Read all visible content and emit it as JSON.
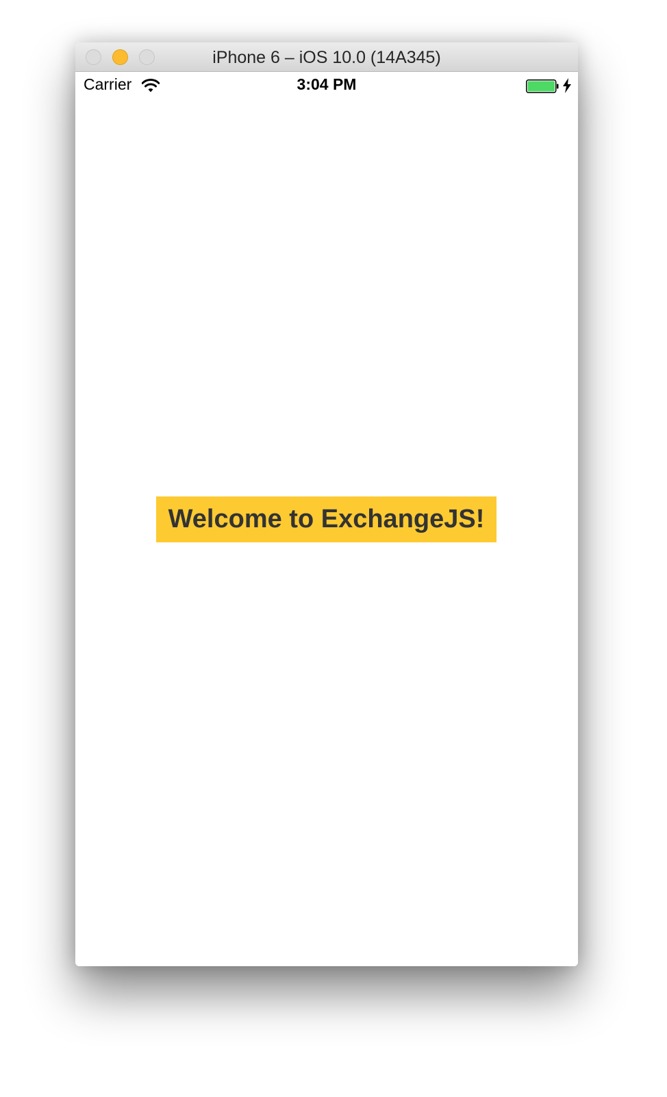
{
  "window": {
    "title": "iPhone 6 – iOS 10.0 (14A345)",
    "controls": [
      "close",
      "minimize",
      "zoom"
    ]
  },
  "status_bar": {
    "carrier": "Carrier",
    "time": "3:04 PM",
    "icons": [
      "wifi-icon",
      "battery-icon",
      "charging-icon"
    ],
    "battery_color": "#4cd964"
  },
  "app": {
    "welcome_text": "Welcome to ExchangeJS!",
    "welcome_background": "#fdca32",
    "welcome_text_color": "#333333"
  }
}
